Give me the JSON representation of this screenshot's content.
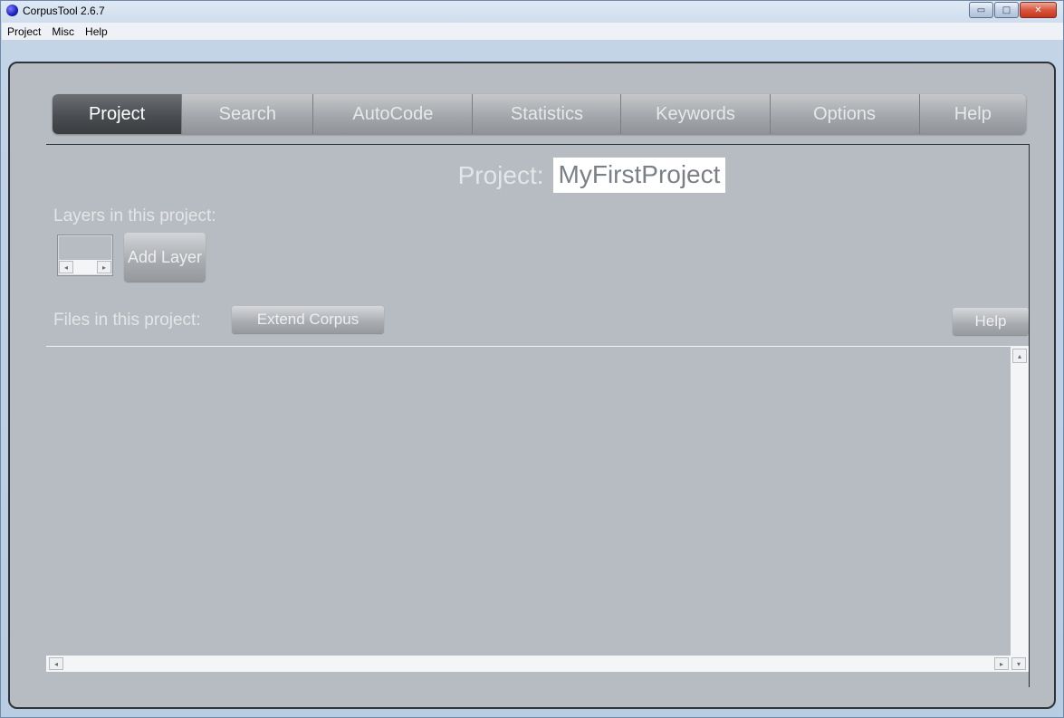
{
  "window": {
    "title": "CorpusTool 2.6.7",
    "controls": {
      "minimize": "▭",
      "maximize": "□",
      "close": "✕"
    }
  },
  "menu": [
    "Project",
    "Misc",
    "Help"
  ],
  "tabs": [
    {
      "label": "Project",
      "active": true
    },
    {
      "label": "Search",
      "active": false
    },
    {
      "label": "AutoCode",
      "active": false
    },
    {
      "label": "Statistics",
      "active": false
    },
    {
      "label": "Keywords",
      "active": false
    },
    {
      "label": "Options",
      "active": false
    },
    {
      "label": "Help",
      "active": false
    }
  ],
  "project": {
    "label": "Project:",
    "name": "MyFirstProject",
    "layers_label": "Layers in this project:",
    "add_layer_label": "Add Layer",
    "files_label": "Files in this project:",
    "extend_corpus_label": "Extend Corpus",
    "help_label": "Help"
  },
  "icons": {
    "app": "blue-orb-icon",
    "scroll_left": "◂",
    "scroll_right": "▸",
    "scroll_up": "▴",
    "scroll_down": "▾"
  },
  "colors": {
    "client_bg": "#b7bcc2",
    "active_tab": "#4a4d51",
    "inactive_tab": "#a4a7ab",
    "project_name_text": "#7b8086"
  }
}
